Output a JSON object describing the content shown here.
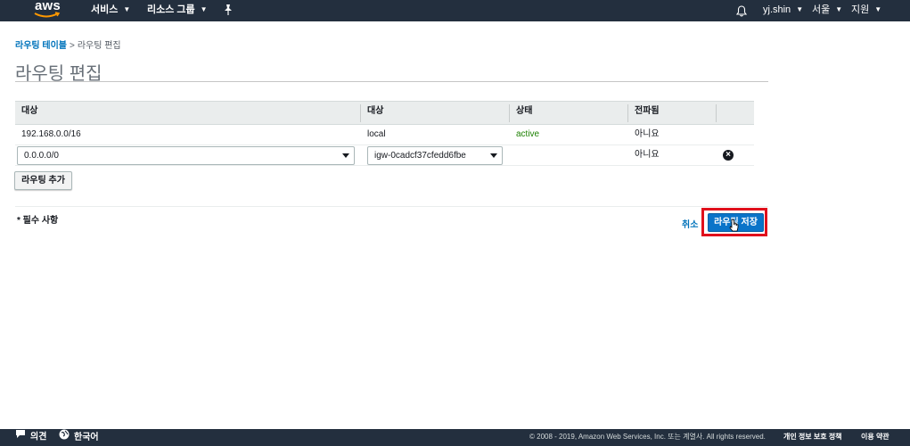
{
  "nav": {
    "logo_text": "aws",
    "services_label": "서비스",
    "resource_groups_label": "리소스 그룹",
    "user_label": "yj.shin",
    "region_label": "서울",
    "support_label": "지원"
  },
  "breadcrumb": {
    "parent_label": "라우팅 테이블",
    "separator": ">",
    "current_label": "라우팅 편집"
  },
  "page_title": "라우팅 편집",
  "table": {
    "headers": [
      "대상",
      "대상",
      "상태",
      "전파됨"
    ],
    "rows": [
      {
        "destination": "192.168.0.0/16",
        "target": "local",
        "status": "active",
        "propagated": "아니요"
      },
      {
        "destination": "0.0.0.0/0",
        "target": "igw-0cadcf37cfedd6fbe",
        "status": "",
        "propagated": "아니요"
      }
    ]
  },
  "add_route_label": "라우팅 추가",
  "required_note": "* 필수 사항",
  "cancel_label": "취소",
  "save_label": "라우팅 저장",
  "footer": {
    "feedback_label": "의견",
    "language_label": "한국어",
    "copyright": "© 2008 - 2019, Amazon Web Services, Inc. 또는 계열사. All rights reserved.",
    "privacy_label": "개인 정보 보호 정책",
    "terms_label": "이용 약관"
  },
  "colors": {
    "nav_bg": "#232f3e",
    "link": "#0073bb",
    "active_status": "#1d8102",
    "primary_button": "#0a74c9",
    "highlight": "#e0101c"
  },
  "icons": [
    "aws-logo-icon",
    "pin-icon",
    "bell-icon",
    "remove-circle-icon",
    "feedback-icon",
    "globe-icon",
    "cursor-icon"
  ]
}
